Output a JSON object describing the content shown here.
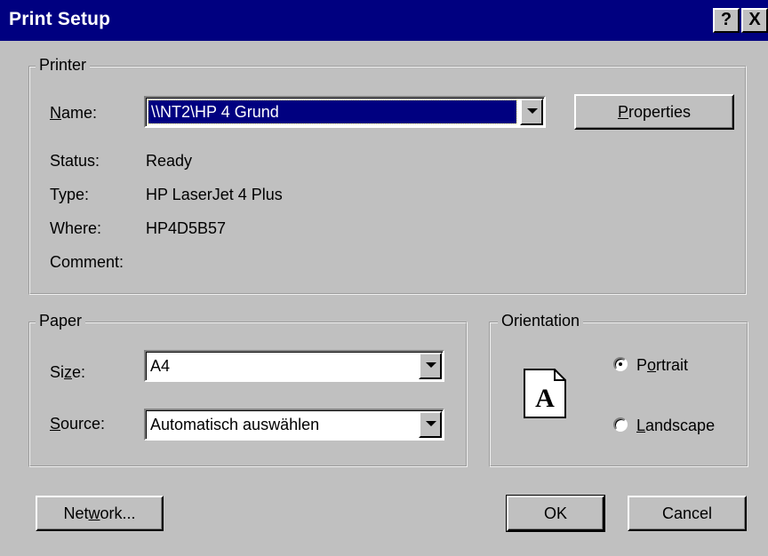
{
  "window": {
    "title": "Print Setup",
    "help_button": "?",
    "close_button": "X"
  },
  "printer": {
    "group_label": "Printer",
    "name_label": "Name:",
    "name_value": "\\\\NT2\\HP 4 Grund",
    "properties_button": "Properties",
    "status_label": "Status:",
    "status_value": "Ready",
    "type_label": "Type:",
    "type_value": "HP LaserJet 4 Plus",
    "where_label": "Where:",
    "where_value": "HP4D5B57",
    "comment_label": "Comment:",
    "comment_value": ""
  },
  "paper": {
    "group_label": "Paper",
    "size_label": "Size:",
    "size_value": "A4",
    "source_label": "Source:",
    "source_value": "Automatisch auswählen"
  },
  "orientation": {
    "group_label": "Orientation",
    "icon_letter": "A",
    "portrait_label": "Portrait",
    "landscape_label": "Landscape",
    "selected": "Portrait"
  },
  "buttons": {
    "network": "Network...",
    "ok": "OK",
    "cancel": "Cancel"
  }
}
